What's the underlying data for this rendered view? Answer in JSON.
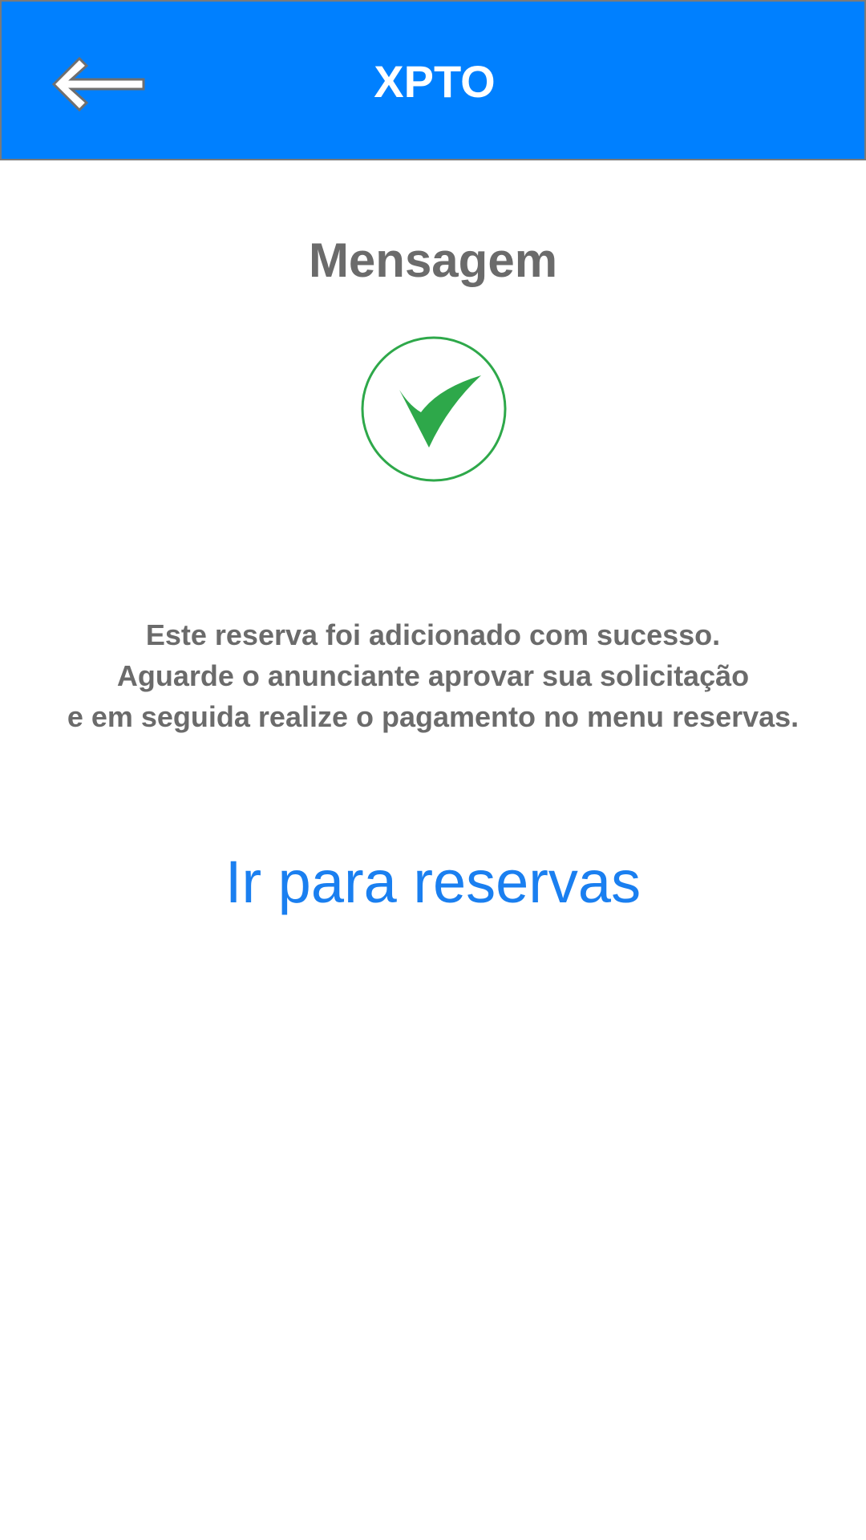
{
  "header": {
    "title": "XPTO",
    "back_icon": "arrow-left-icon",
    "background_color": "#0080ff"
  },
  "main": {
    "title": "Mensagem",
    "status_icon": "checkmark-circle-icon",
    "status_color": "#2ea84a",
    "message_lines": [
      "Este reserva foi adicionado com sucesso.",
      "Aguarde o anunciante aprovar sua solicitação",
      "e em seguida realize o pagamento no menu reservas."
    ],
    "link_label": "Ir para reservas",
    "link_color": "#1a7ff0"
  }
}
